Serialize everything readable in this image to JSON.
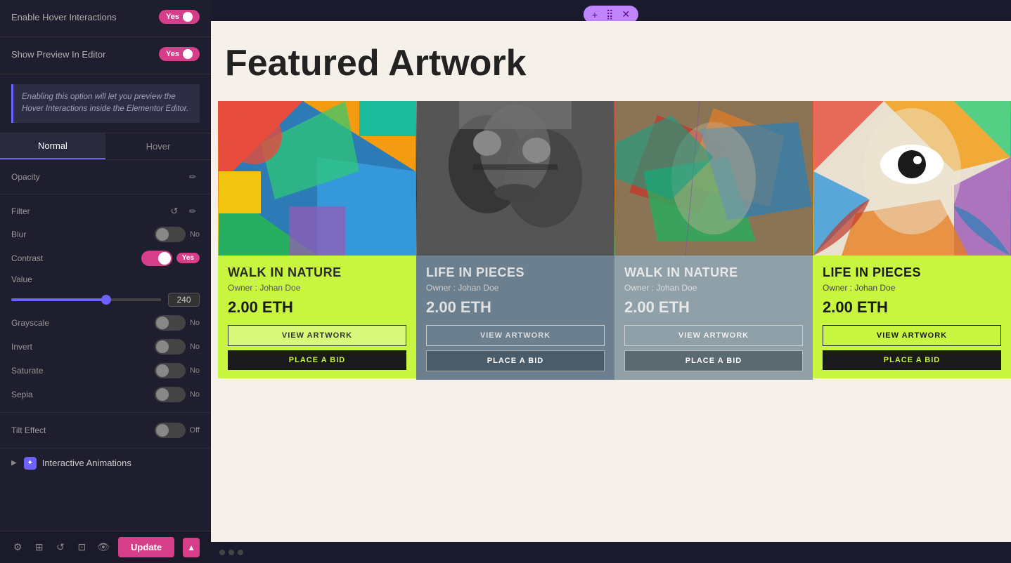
{
  "panel": {
    "hover_interactions_label": "Enable Hover Interactions",
    "hover_interactions_value": "Yes",
    "show_preview_label": "Show Preview In Editor",
    "show_preview_value": "Yes",
    "info_text": "Enabling this option will let you preview the Hover Interactions inside the Elementor Editor.",
    "tab_normal": "Normal",
    "tab_hover": "Hover",
    "opacity_label": "Opacity",
    "filter_label": "Filter",
    "blur_label": "Blur",
    "blur_value": "No",
    "contrast_label": "Contrast",
    "contrast_value": "Yes",
    "value_label": "Value",
    "slider_value": "240",
    "grayscale_label": "Grayscale",
    "grayscale_value": "No",
    "invert_label": "Invert",
    "invert_value": "No",
    "saturate_label": "Saturate",
    "saturate_value": "No",
    "sepia_label": "Sepia",
    "sepia_value": "No",
    "tilt_label": "Tilt Effect",
    "tilt_value": "Off",
    "animations_label": "Interactive Animations",
    "update_btn": "Update"
  },
  "canvas": {
    "section_title": "Featured Artwork",
    "cards": [
      {
        "title": "WALK IN NATURE",
        "owner": "Owner : Johan Doe",
        "price": "2.00 ETH",
        "view_btn": "VIEW ARTWORK",
        "bid_btn": "PLACE A BID",
        "style": "1"
      },
      {
        "title": "LIFE IN PIECES",
        "owner": "Owner : Johan Doe",
        "price": "2.00 ETH",
        "view_btn": "VIEW ARTWORK",
        "bid_btn": "PLACE A BID",
        "style": "2"
      },
      {
        "title": "WALK IN NATURE",
        "owner": "Owner : Johan Doe",
        "price": "2.00 ETH",
        "view_btn": "VIEW ARTWORK",
        "bid_btn": "PLACE A BID",
        "style": "3"
      },
      {
        "title": "LIFE IN PIECES",
        "owner": "Owner : Johan Doe",
        "price": "2.00 ETH",
        "view_btn": "VIEW ARTWORK",
        "bid_btn": "PLACE A BID",
        "style": "4"
      }
    ]
  },
  "toolbar": {
    "settings_icon": "⚙",
    "layers_icon": "⊞",
    "history_icon": "↺",
    "responsive_icon": "⊡",
    "preview_icon": "👁",
    "update_label": "Update"
  }
}
